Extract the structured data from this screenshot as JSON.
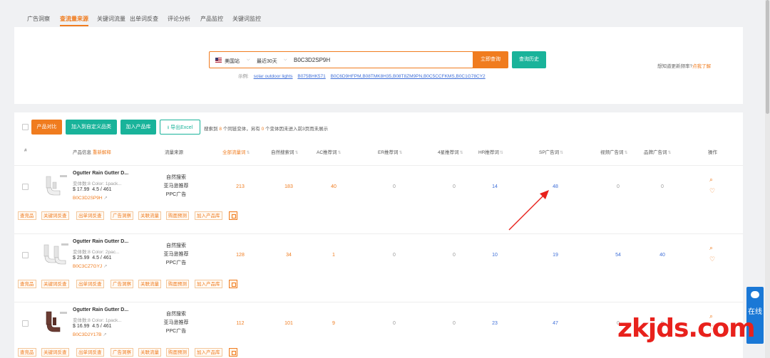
{
  "tabs": [
    "广告洞察",
    "查流量来源",
    "关键词流量",
    "出单词反查",
    "评论分析",
    "产品监控",
    "关键词监控"
  ],
  "active_tab_index": 1,
  "search": {
    "site": "美国站",
    "range": "最近30天",
    "asin_value": "B0C3D2SP9H",
    "query_button": "立即查询",
    "history_button": "查询历史",
    "examples_label": "示例:",
    "examples": [
      "solar outdoor lights",
      "B075BHK571",
      "B0C6D9HFPM,B08TMK8H35,B08T8ZM9PN,B0C5CCFKMS,B0C1G78CY2"
    ]
  },
  "promo": {
    "text": "想知道更新频率?",
    "link": "点我了解"
  },
  "toolbar": {
    "compare": "产品对比",
    "add_custom": "加入到自定义品类",
    "add_library": "加入产品库",
    "export": "导出Excel",
    "summary_prefix": "搜索到",
    "summary_count1": "8",
    "summary_mid": "个同链变体，另有",
    "summary_count2": "0",
    "summary_suffix": "个变体因未进入前3页而未展示"
  },
  "columns": {
    "index": "#",
    "product": "产品信息",
    "product_link": "重新解释",
    "source": "流量来源",
    "total": "全部流量词",
    "organic": "自然搜索词",
    "ac": "AC推荐词",
    "er": "ER推荐词",
    "star4": "4星推荐词",
    "hr": "HR推荐词",
    "sp": "SP广告词",
    "video": "视频广告词",
    "brand": "品牌广告词",
    "ops": "操作"
  },
  "sources": [
    "自然搜索",
    "亚马逊推荐",
    "PPC广告"
  ],
  "row_tags": [
    "查竞品",
    "关键词反查",
    "出单词反查",
    "广告洞察",
    "关联流量",
    "购面预测",
    "加入产品库"
  ],
  "products": [
    {
      "title": "Ogutter Rain Gutter D...",
      "meta": "变体数:8    Color: 1pack...",
      "price": "$ 17.99",
      "rating": "4.5 / 461",
      "asin": "B0C3D2SP9H",
      "total": "213",
      "organic": "183",
      "ac": "40",
      "er": "0",
      "star4": "0",
      "hr": "14",
      "sp": "48",
      "video": "0",
      "brand": "0"
    },
    {
      "title": "Ogutter Rain Gutter D...",
      "meta": "变体数:8    Color: 2pac...",
      "price": "$ 25.99",
      "rating": "4.5 / 461",
      "asin": "B0C3CZ7GYJ",
      "total": "128",
      "organic": "34",
      "ac": "1",
      "er": "0",
      "star4": "0",
      "hr": "10",
      "sp": "19",
      "video": "54",
      "brand": "40"
    },
    {
      "title": "Ogutter Rain Gutter D...",
      "meta": "变体数:8    Color: 1pack...",
      "price": "$ 16.99",
      "rating": "4.5 / 461",
      "asin": "B0C3D2Y17B",
      "total": "112",
      "organic": "101",
      "ac": "9",
      "er": "0",
      "star4": "0",
      "hr": "23",
      "sp": "47",
      "video": "0",
      "brand": "0"
    }
  ],
  "side_chat": "在线",
  "watermark": "zkjds.com",
  "colors": {
    "accent": "#f07c1f",
    "teal": "#19b39a",
    "blue": "#3f6fd8",
    "annotation_arrow": "#e8211c"
  }
}
